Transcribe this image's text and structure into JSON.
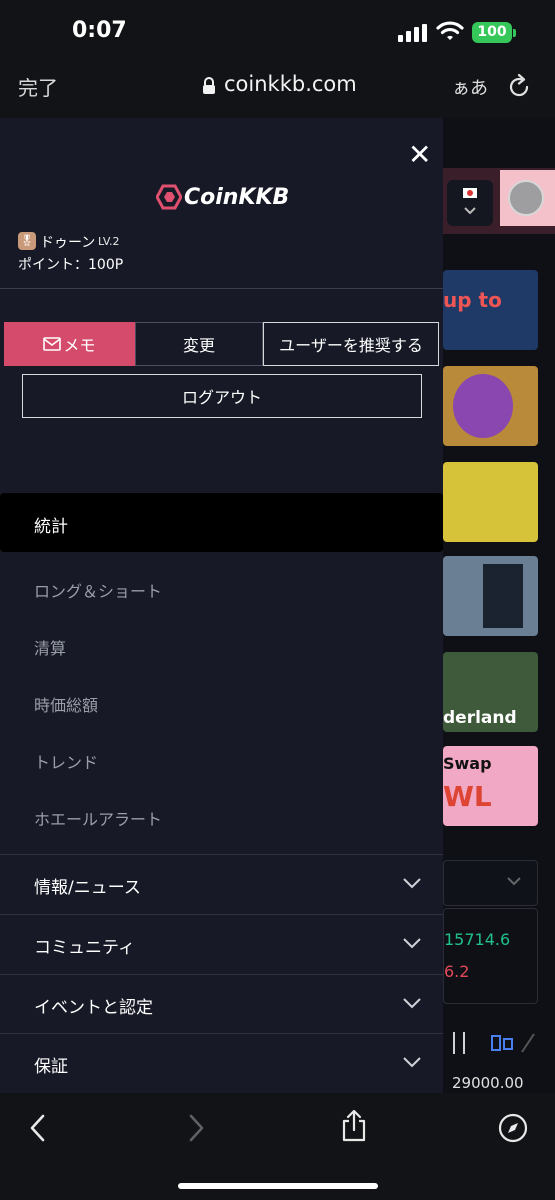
{
  "status_bar": {
    "time": "0:07",
    "battery": "100"
  },
  "url_bar": {
    "done_label": "完了",
    "url": "coinkkb.com",
    "text_size_label": "ぁあ"
  },
  "drawer": {
    "logo_text": "CoinKKB",
    "user": {
      "name": "ドゥーン",
      "level": "LV.2",
      "points": "ポイント：100P"
    },
    "buttons": {
      "memo": "メモ",
      "change": "変更",
      "recommend": "ユーザーを推奨する",
      "logout": "ログアウト"
    },
    "active_menu": "統計",
    "submenu": [
      "ロング＆ショート",
      "清算",
      "時価総額",
      "トレンド",
      "ホエールアラート"
    ],
    "sections": [
      "情報/ニュース",
      "コミュニティ",
      "イベントと認定",
      "保証"
    ]
  },
  "background_page": {
    "number_1": "15714.6",
    "number_2": "6.2",
    "price": "29000.00",
    "banner_text_1": "up to",
    "banner_text_2": "derland",
    "banner_text_3": "Swap",
    "banner_text_4": "WL"
  },
  "colors": {
    "accent": "#d54b6b",
    "drawer_bg": "#171a26",
    "positive": "#21c08a",
    "negative": "#e04a5a"
  }
}
